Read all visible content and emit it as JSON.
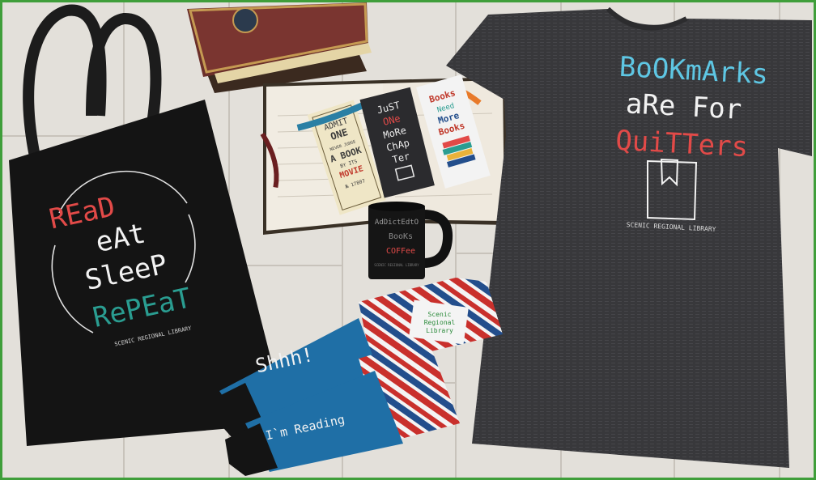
{
  "tote": {
    "line1": "REaD",
    "line2": "eAt",
    "line3": "SleeP",
    "line4": "RePEaT",
    "library": "SCENIC REGIONAL LIBRARY"
  },
  "shirt": {
    "line1": "BoOKmArks",
    "line2": "aRe For",
    "line3": "QuiTTers",
    "library": "SCENIC REGIONAL LIBRARY"
  },
  "bookmarks": {
    "admit": {
      "l1": "ADMIT",
      "l2": "ONE",
      "l3": "NEVER JUDGE",
      "l4": "A BOOK",
      "l5": "BY ITS",
      "l6": "MOVIE",
      "l7": "№ 17807"
    },
    "chapter": {
      "l1": "JuST",
      "l2": "ONe",
      "l3": "MoRe",
      "l4": "ChAp",
      "l5": "Ter"
    },
    "books": {
      "l1": "Books",
      "l2": "Need",
      "l3": "More",
      "l4": "Books"
    }
  },
  "mug": {
    "line1": "AdDictEdtO",
    "line2": "BooKs",
    "line3": "COFFee",
    "library": "SCENIC REGIONAL LIBRARY"
  },
  "socks": {
    "sock1": "Shhh!",
    "sock2": "I`m Reading",
    "badge1": "Scenic",
    "badge2": "Regional",
    "badge3": "Library"
  },
  "colors": {
    "frame": "#3f9e3a",
    "wood": "#e6e3de",
    "tote": "#141414",
    "shirt": "#3a3a3c",
    "red": "#e24a48",
    "teal": "#2a9d91",
    "cyan": "#5ec6e3",
    "sockBlue": "#1f6fa6"
  }
}
